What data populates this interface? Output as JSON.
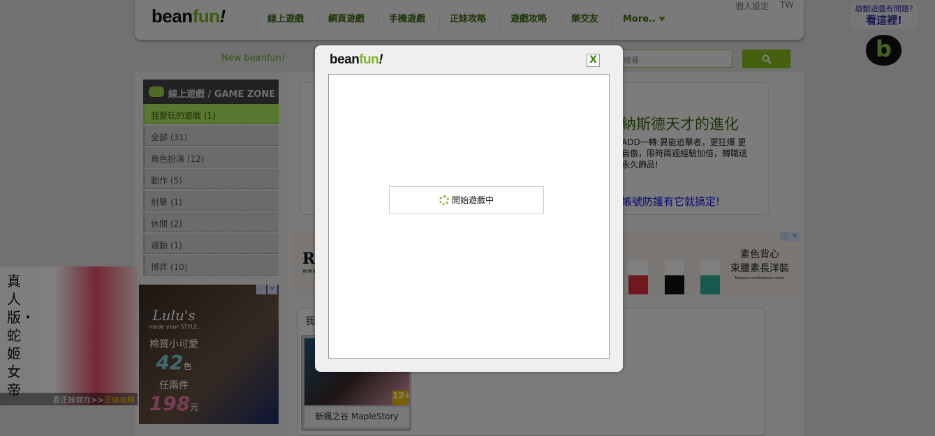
{
  "header": {
    "logo": {
      "bean": "bean",
      "fun": "fun",
      "ex": "!"
    },
    "nav": [
      "線上遊戲",
      "網頁遊戲",
      "手機遊戲",
      "正妹攻略",
      "遊戲攻略",
      "樂交友",
      "More.."
    ],
    "personal_settings": "個人設定",
    "region": "TW"
  },
  "subheader": {
    "new_beanfun": "New beanfun!",
    "search_placeholder": "自訂搜尋"
  },
  "help": {
    "line1": "啟動遊戲有問題?",
    "line2": "看這裡!",
    "badge": "b"
  },
  "sidebar": {
    "title": "線上遊戲 / GAME ZONE",
    "items": [
      {
        "label": "我愛玩的遊戲 (1)",
        "active": true
      },
      {
        "label": "全部 (31)"
      },
      {
        "label": "角色扮演 (12)"
      },
      {
        "label": "動作 (5)"
      },
      {
        "label": "射擊 (1)"
      },
      {
        "label": "休閒 (2)"
      },
      {
        "label": "運動 (1)"
      },
      {
        "label": "博弈 (10)"
      }
    ]
  },
  "feature": {
    "title": "納斯德天才的進化",
    "desc": [
      "ADD一轉:異能追擊者，更狂爆 更",
      "自傲，限時兩週經驗加倍，轉職送",
      "永久飾品!"
    ],
    "link": "帳號防護有它就搞定!"
  },
  "ad_banner": {
    "line1": "素色背心",
    "line2": "束腰素長洋裝",
    "small": "Macaron multicolored shorts",
    "partial": "R",
    "partial2": "www"
  },
  "my_games": {
    "title": "我",
    "card_label": "新楓之谷 MapleStory",
    "rating": "12+"
  },
  "left_ad": {
    "vertical": "真人版・蛇姬女帝",
    "bar": "看正妹就在>>",
    "bar_link": "正妹攻略"
  },
  "right_ad": {
    "brand": "Lulu's",
    "tagline": "made your STYLE.",
    "l1": "棉質小可愛",
    "n1": "42",
    "u1": "色",
    "l2": "任兩件",
    "n2": "198",
    "u2": "元"
  },
  "modal": {
    "logo": {
      "bean": "bean",
      "fun": "fun",
      "ex": "!"
    },
    "close": "X",
    "loading": "開始遊戲中"
  }
}
